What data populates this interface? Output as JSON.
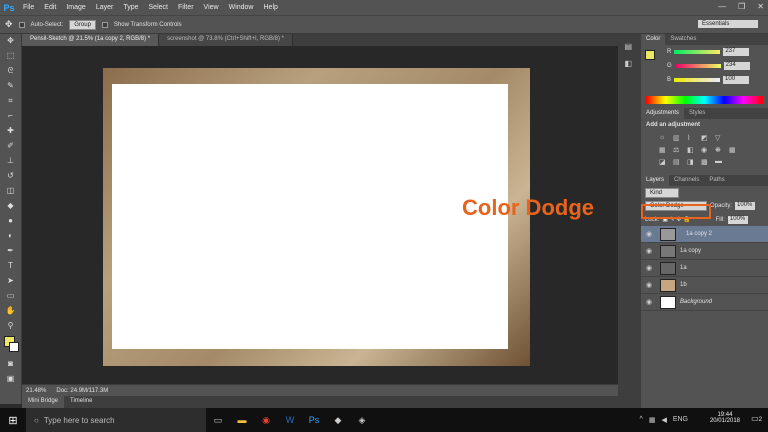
{
  "menu": [
    "File",
    "Edit",
    "Image",
    "Layer",
    "Type",
    "Select",
    "Filter",
    "View",
    "Window",
    "Help"
  ],
  "options": {
    "auto_select": "Auto-Select:",
    "group": "Group",
    "transform": "Show Transform Controls",
    "workspace": "Essentials"
  },
  "tabs": [
    "Pensil-Sketch @ 21.5% (1a copy 2, RGB/8) *",
    "screenshot @ 73.8% (Ctrl+Shift+I, RGB/8) *"
  ],
  "status": {
    "zoom": "21.48%",
    "doc": "Doc: 24.9M/117.3M"
  },
  "bottom_tabs": [
    "Mini Bridge",
    "Timeline"
  ],
  "color_panel": {
    "tabs": [
      "Color",
      "Swatches"
    ],
    "r": "237",
    "g": "234",
    "b": "100",
    "r_label": "R",
    "g_label": "G",
    "b_label": "B"
  },
  "adjust": {
    "tabs": [
      "Adjustments",
      "Styles"
    ],
    "title": "Add an adjustment"
  },
  "layers": {
    "tabs": [
      "Layers",
      "Channels",
      "Paths"
    ],
    "kind": "Kind",
    "blend": "Color Dodge",
    "opacity_label": "Opacity:",
    "opacity": "100%",
    "lock_label": "Lock:",
    "fill_label": "Fill:",
    "fill": "100%",
    "items": [
      "1a copy 2",
      "1a copy",
      "1a",
      "1b",
      "Background"
    ]
  },
  "annotation": "Color Dodge",
  "taskbar": {
    "search": "Type here to search",
    "lang": "ENG",
    "time": "19:44",
    "date": "20/01/2018",
    "notif": "2"
  }
}
